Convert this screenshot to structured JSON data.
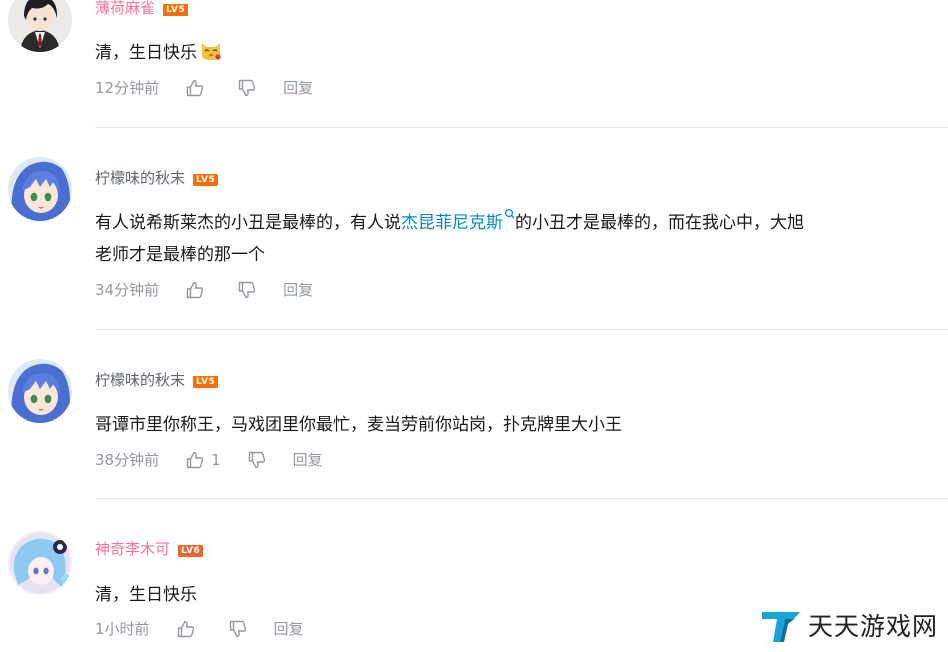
{
  "comments": [
    {
      "username": "薄荷麻雀",
      "level": "LV5",
      "text": "清，生日快乐",
      "emoji": "cat-emoji",
      "time": "12分钟前",
      "reply": "回复"
    },
    {
      "username": "柠檬味的秋末",
      "level": "LV5",
      "text_before": "有人说希斯莱杰的小丑是最棒的，有人说",
      "link": "杰昆菲尼克斯",
      "text_after_line1": "的小丑才是最棒的，而在我心中，大旭",
      "text_line2": "老师才是最棒的那一个",
      "time": "34分钟前",
      "reply": "回复"
    },
    {
      "username": "柠檬味的秋末",
      "level": "LV5",
      "text": "哥谭市里你称王，马戏团里你最忙，麦当劳前你站岗，扑克牌里大小王",
      "time": "38分钟前",
      "likes": "1",
      "reply": "回复"
    },
    {
      "username": "神奇李木可",
      "level": "LV6",
      "text": "清，生日快乐",
      "time": "1小时前",
      "reply": "回复"
    }
  ],
  "watermark": {
    "text": "天天游戏网"
  },
  "colors": {
    "pink_name": "#fb7299",
    "link": "#008ac5",
    "meta": "#9499a0",
    "divider": "#e3e5e7"
  }
}
